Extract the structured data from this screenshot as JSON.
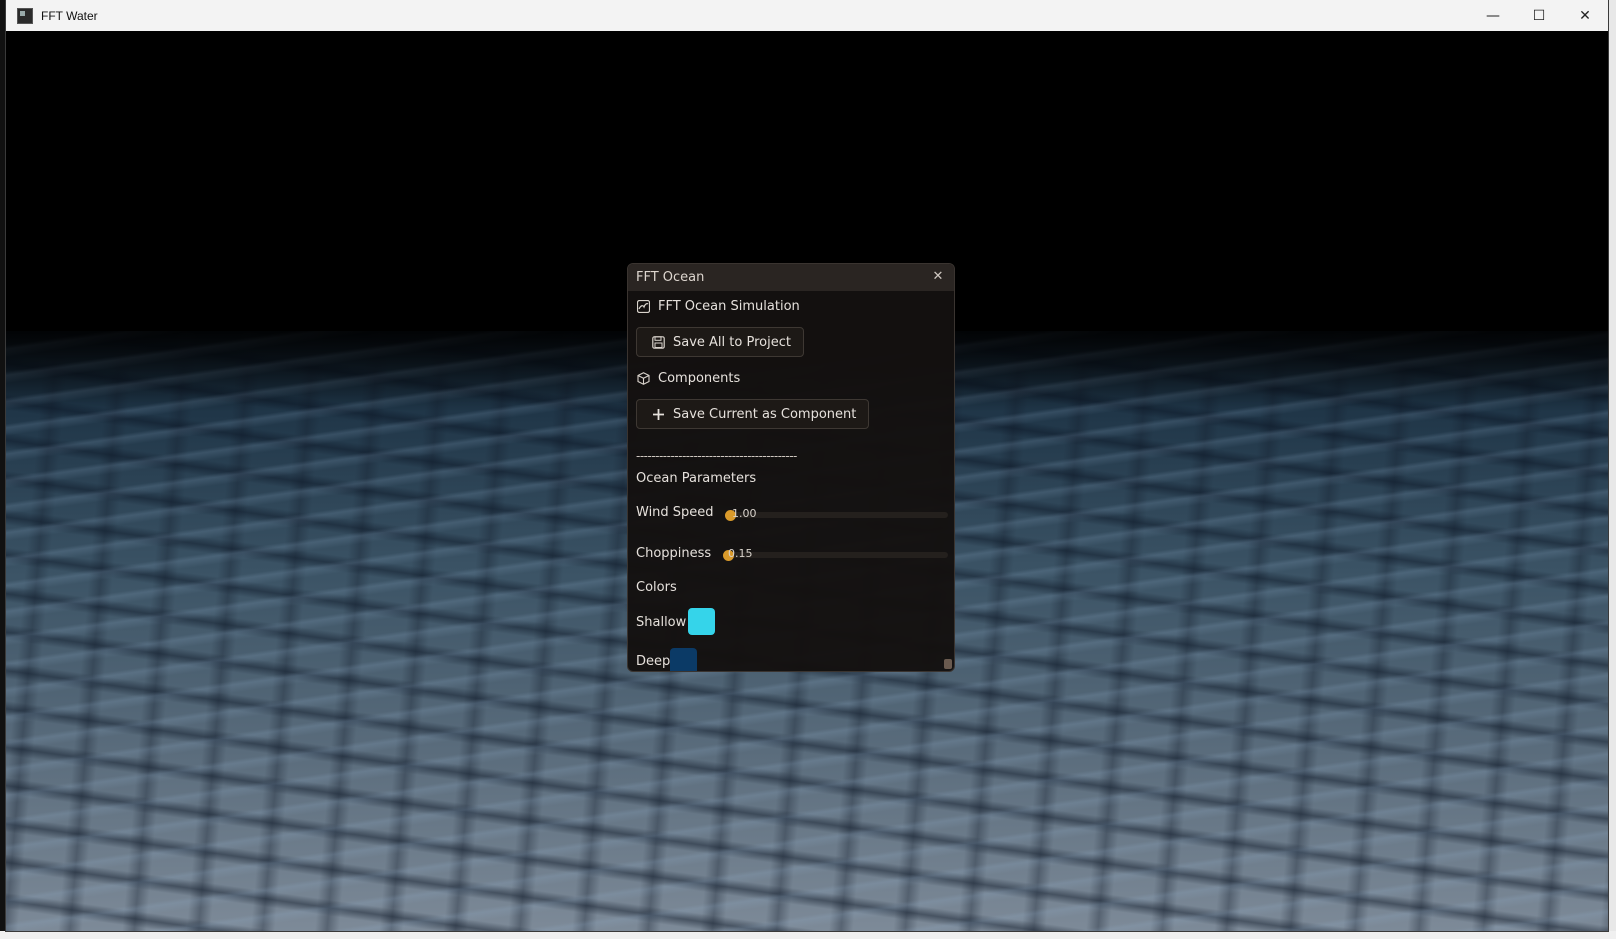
{
  "window": {
    "title": "FFT Water",
    "minimize_glyph": "—",
    "maximize_glyph": "☐",
    "close_glyph": "✕"
  },
  "panel": {
    "title": "FFT Ocean",
    "close_glyph": "✕",
    "simulation_header": "FFT Ocean Simulation",
    "save_all_label": "Save All to Project",
    "components_header": "Components",
    "save_component_label": "Save Current as Component",
    "separator_text": "------------------------------------------",
    "ocean_params_header": "Ocean Parameters",
    "wind_speed": {
      "label": "Wind Speed",
      "value_text": "1.00",
      "fraction": 0.0
    },
    "choppiness": {
      "label": "Choppiness",
      "value_text": "0.15",
      "fraction": 0.0
    },
    "colors_header": "Colors",
    "shallow": {
      "label": "Shallow",
      "color": "#35d4ea"
    },
    "deep": {
      "label": "Deep",
      "color": "#0b3a66"
    }
  },
  "colors": {
    "accent": "#d99a2b",
    "panel_bg": "#14110f",
    "panel_header": "#2a2522"
  },
  "icons": {
    "app": "app-window-icon",
    "simulation": "ocean-wave-icon",
    "save": "floppy-disk-icon",
    "components": "cube-icon",
    "add": "plus-icon"
  }
}
